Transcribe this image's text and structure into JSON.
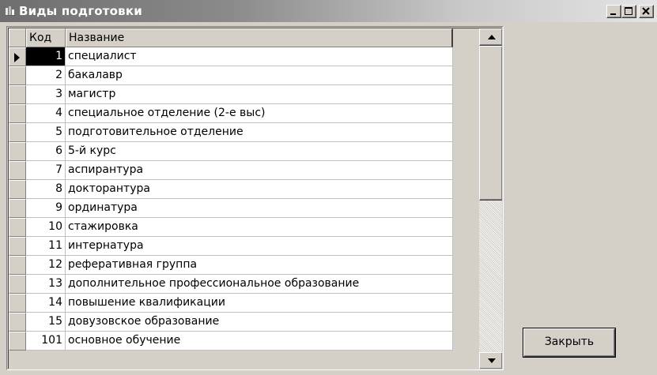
{
  "window": {
    "title": "Виды подготовки",
    "icon": "app-icon",
    "controls": [
      "minimize-icon",
      "maximize-icon",
      "close-icon"
    ]
  },
  "grid": {
    "columns": {
      "code": "Код",
      "name": "Название"
    },
    "selected_row": 0,
    "rows": [
      {
        "code": "1",
        "name": "специалист"
      },
      {
        "code": "2",
        "name": "бакалавр"
      },
      {
        "code": "3",
        "name": "магистр"
      },
      {
        "code": "4",
        "name": "специальное отделение  (2-е выс)"
      },
      {
        "code": "5",
        "name": "подготовительное отделение"
      },
      {
        "code": "6",
        "name": "5-й курс"
      },
      {
        "code": "7",
        "name": "аспирантура"
      },
      {
        "code": "8",
        "name": "докторантура"
      },
      {
        "code": "9",
        "name": "ординатура"
      },
      {
        "code": "10",
        "name": "стажировка"
      },
      {
        "code": "11",
        "name": "интернатура"
      },
      {
        "code": "12",
        "name": "реферативная группа"
      },
      {
        "code": "13",
        "name": "дополнительное профессиональное образование"
      },
      {
        "code": "14",
        "name": "повышение квалификации"
      },
      {
        "code": "15",
        "name": "довузовское образование"
      },
      {
        "code": "101",
        "name": "основное обучение"
      }
    ]
  },
  "buttons": {
    "close_label": "Закрыть"
  },
  "colors": {
    "face": "#d4d0c8",
    "cell_background": "#ffffff",
    "selection": "#000000"
  }
}
